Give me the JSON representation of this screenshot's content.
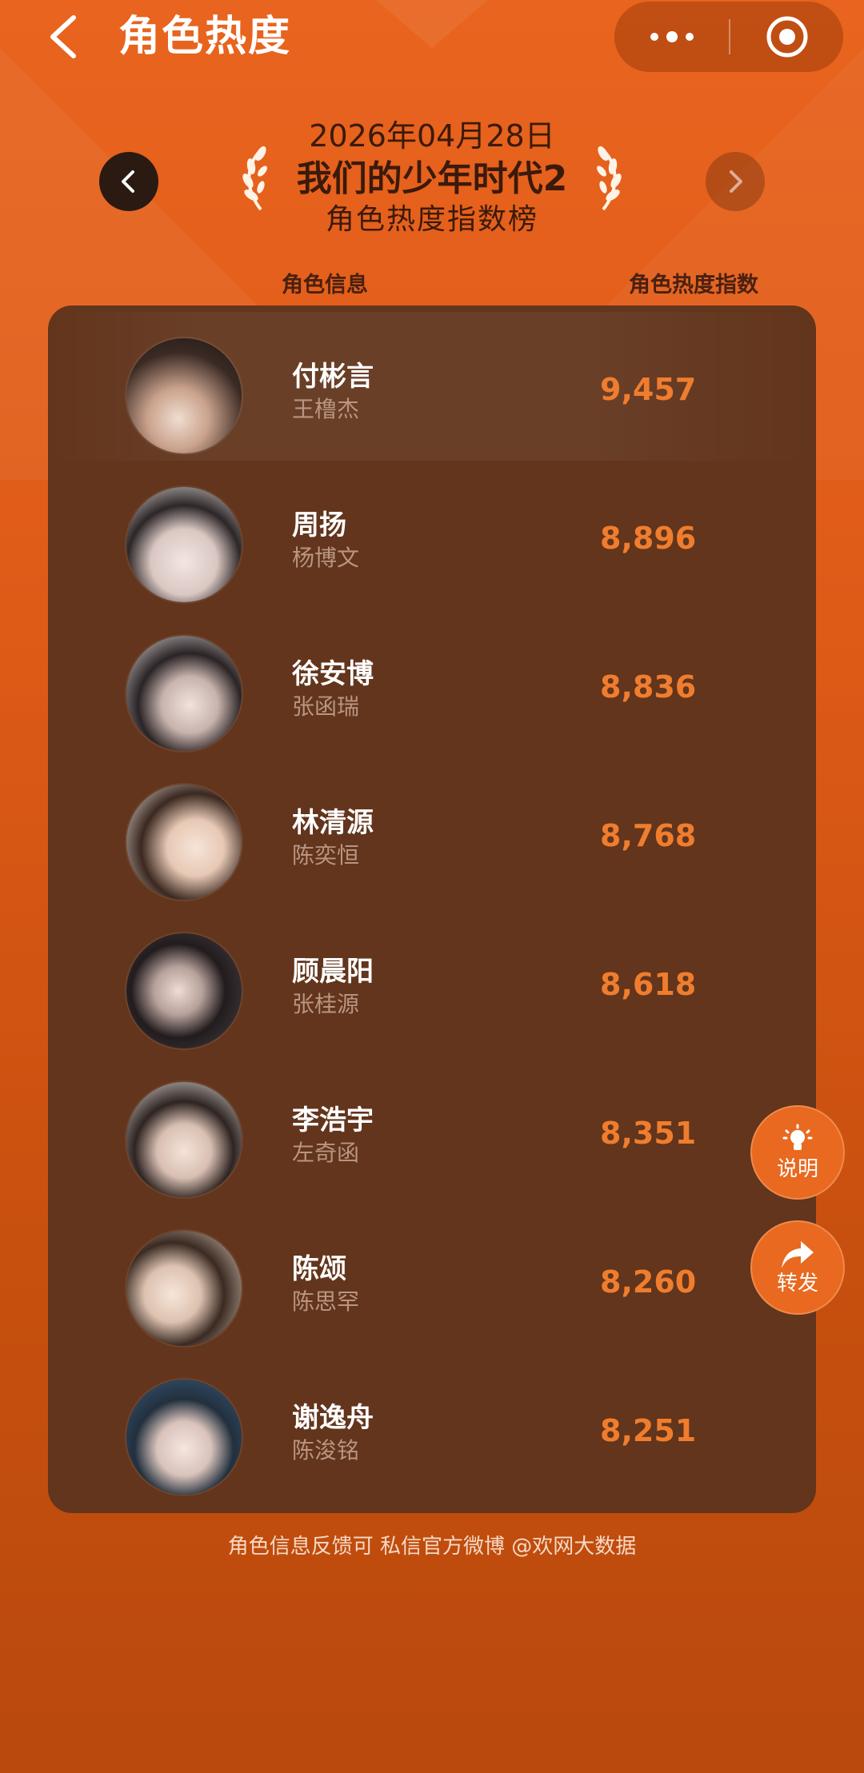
{
  "nav": {
    "title": "角色热度"
  },
  "header": {
    "date": "2026年04月28日",
    "show": "我们的少年时代2",
    "subtitle": "角色热度指数榜"
  },
  "columns": {
    "info": "角色信息",
    "index": "角色热度指数"
  },
  "rows": [
    {
      "role": "付彬言",
      "actor": "王橹杰",
      "score": "9,457"
    },
    {
      "role": "周扬",
      "actor": "杨博文",
      "score": "8,896"
    },
    {
      "role": "徐安博",
      "actor": "张函瑞",
      "score": "8,836"
    },
    {
      "role": "林清源",
      "actor": "陈奕恒",
      "score": "8,768"
    },
    {
      "role": "顾晨阳",
      "actor": "张桂源",
      "score": "8,618"
    },
    {
      "role": "李浩宇",
      "actor": "左奇函",
      "score": "8,351"
    },
    {
      "role": "陈颂",
      "actor": "陈思罕",
      "score": "8,260"
    },
    {
      "role": "谢逸舟",
      "actor": "陈浚铭",
      "score": "8,251"
    }
  ],
  "footnote": "角色信息反馈可 私信官方微博 @欢网大数据",
  "float": {
    "explain": "说明",
    "share": "转发"
  },
  "icons": {
    "back": "chevron-left-icon",
    "more": "more-dots-icon",
    "target": "target-circle-icon",
    "prev": "chevron-left-icon",
    "next": "chevron-right-icon",
    "explain": "lightbulb-icon",
    "share": "share-arrow-icon"
  },
  "colors": {
    "background": "#e0601b",
    "panel": "#62351c",
    "score": "#f07d2e",
    "float_button": "#e8691f"
  }
}
